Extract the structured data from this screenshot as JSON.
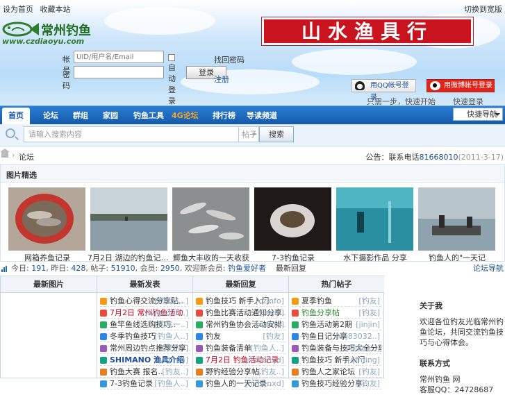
{
  "topbar": {
    "links": [
      "设为首页",
      "收藏本站"
    ],
    "right": "切换到宽版"
  },
  "logo": {
    "name": "常州钓鱼",
    "url": "www.czdiaoyu.com"
  },
  "ad": {
    "text": "山水渔具行"
  },
  "login": {
    "user_label": "帐号",
    "user_placeholder": "UID/用户名/Email",
    "pass_label": "密码",
    "remember": "自动登录",
    "submit": "登录",
    "find_password": "找回密码",
    "register": "注册"
  },
  "social": {
    "qq_button": "用QQ帐号登录",
    "qq_caption": "只需一步，快速开始",
    "weibo_button": "用微博帐号登录",
    "weibo_caption": "快速登录"
  },
  "nav": {
    "items": [
      "首页",
      "论坛",
      "群组",
      "家园",
      "钓鱼工具",
      "4G论坛",
      "排行榜",
      "导读频道"
    ],
    "quick": "快捷导航"
  },
  "search": {
    "placeholder": "请输入搜索内容",
    "type": "帖子",
    "button": "搜索"
  },
  "breadcrumb": {
    "current": "论坛",
    "announcement_prefix": "公告：联系电话",
    "announcement_number": "81668010",
    "announcement_date": "(2011-3-17)"
  },
  "gallery": {
    "title": "图片精选",
    "captions": [
      "网箱养鱼记录",
      "7月2日 湖边的钓鱼记录活动 出水\"...",
      "鲫鱼大丰收的一天收获",
      "7-3钓鱼记录",
      "水下摄影作品 分享",
      "钓鱼人的\"一天记"
    ]
  },
  "stats": {
    "today_label": "今日",
    "today": "191",
    "yesterday_label": "昨日",
    "yesterday": "428",
    "posts_label": "帖子",
    "posts": "51910",
    "members_label": "会员",
    "members": "2950",
    "newest_label": "欢迎新会员",
    "newest": "钓鱼爱好者",
    "extra": "最新回复",
    "right_link": "论坛导航"
  },
  "hot": {
    "columns": [
      "最新图片",
      "最新发表",
      "最新回复",
      "热门帖子"
    ],
    "col2": [
      {
        "title": "钓鱼心得交流分享贴..",
        "author": "[钓鱼人..]",
        "style": "t"
      },
      {
        "title": "7月2日 常州钓鱼活动",
        "author": "[wjgk300..]",
        "style": "red"
      },
      {
        "title": "鱼竿鱼线选购技巧..",
        "author": "[钓友一..]",
        "style": "t"
      },
      {
        "title": "冬季钓鱼技巧",
        "author": "[钓鱼人..]",
        "style": "t"
      },
      {
        "title": "常州周边钓点推荐分享..",
        "author": "[老钓..]",
        "style": "t"
      },
      {
        "title": "SHIMANO 渔具介绍",
        "author": "[admin]",
        "style": "blu"
      },
      {
        "title": "钓鱼大赛 报名..",
        "author": "[钓友..]",
        "style": "t"
      },
      {
        "title": "7-3钓鱼记录",
        "author": "[钓鱼人..]",
        "style": "t"
      }
    ],
    "col3": [
      {
        "title": "钓鱼技巧 新手入门..",
        "author": "[czinfo]",
        "style": "t"
      },
      {
        "title": "钓鱼比赛活动通知分享..",
        "author": "[jinjin]",
        "style": "t"
      },
      {
        "title": "常州钓鱼协会活动安排..",
        "author": "[czinfo]",
        "style": "t"
      },
      {
        "title": "钓友",
        "author": "[钓友]",
        "style": "t"
      },
      {
        "title": "钓鱼装备清单",
        "author": "[钓鱼人..]",
        "style": "t"
      },
      {
        "title": "7月2日 钓鱼活动记录",
        "author": "[nimenxd]",
        "style": "red"
      },
      {
        "title": "野钓经验分享帖..",
        "author": "[钓友..]",
        "style": "t"
      },
      {
        "title": "钓鱼人的一天记录..",
        "author": "[nimenxd]",
        "style": "t"
      }
    ],
    "col4": [
      {
        "title": "夏季钓鱼",
        "author": "[钓友]",
        "style": "t"
      },
      {
        "title": "钓鱼分享帖",
        "author": "[钓友]",
        "style": "grn"
      },
      {
        "title": "钓鱼活动第2期",
        "author": "[jinjin]",
        "style": "t"
      },
      {
        "title": "钓鱼日记分享",
        "author": "[dlj83032..]",
        "style": "t"
      },
      {
        "title": "钓鱼装备与技巧大全分享..",
        "author": "[钓鱼人..]",
        "style": "t"
      },
      {
        "title": "钓鱼技巧 新手入门..",
        "author": "[qfming]",
        "style": "t"
      },
      {
        "title": "钓鱼人之家论坛",
        "author": "[钓友]",
        "style": "t"
      },
      {
        "title": "钓鱼技巧经验分享..",
        "author": "[钓友]",
        "style": "t"
      }
    ]
  },
  "side": {
    "title1": "关于我",
    "text1": "欢迎各位钓友光临常州钓鱼论坛，共同交流钓鱼技巧与心得体会。",
    "title2": "联系方式",
    "text2": "常州钓鱼 网",
    "text3": "客服QQ：24728687"
  },
  "colors": {
    "nav": "#1f6fc4",
    "accent": "#c9141f",
    "link": "#1c4f9c"
  }
}
